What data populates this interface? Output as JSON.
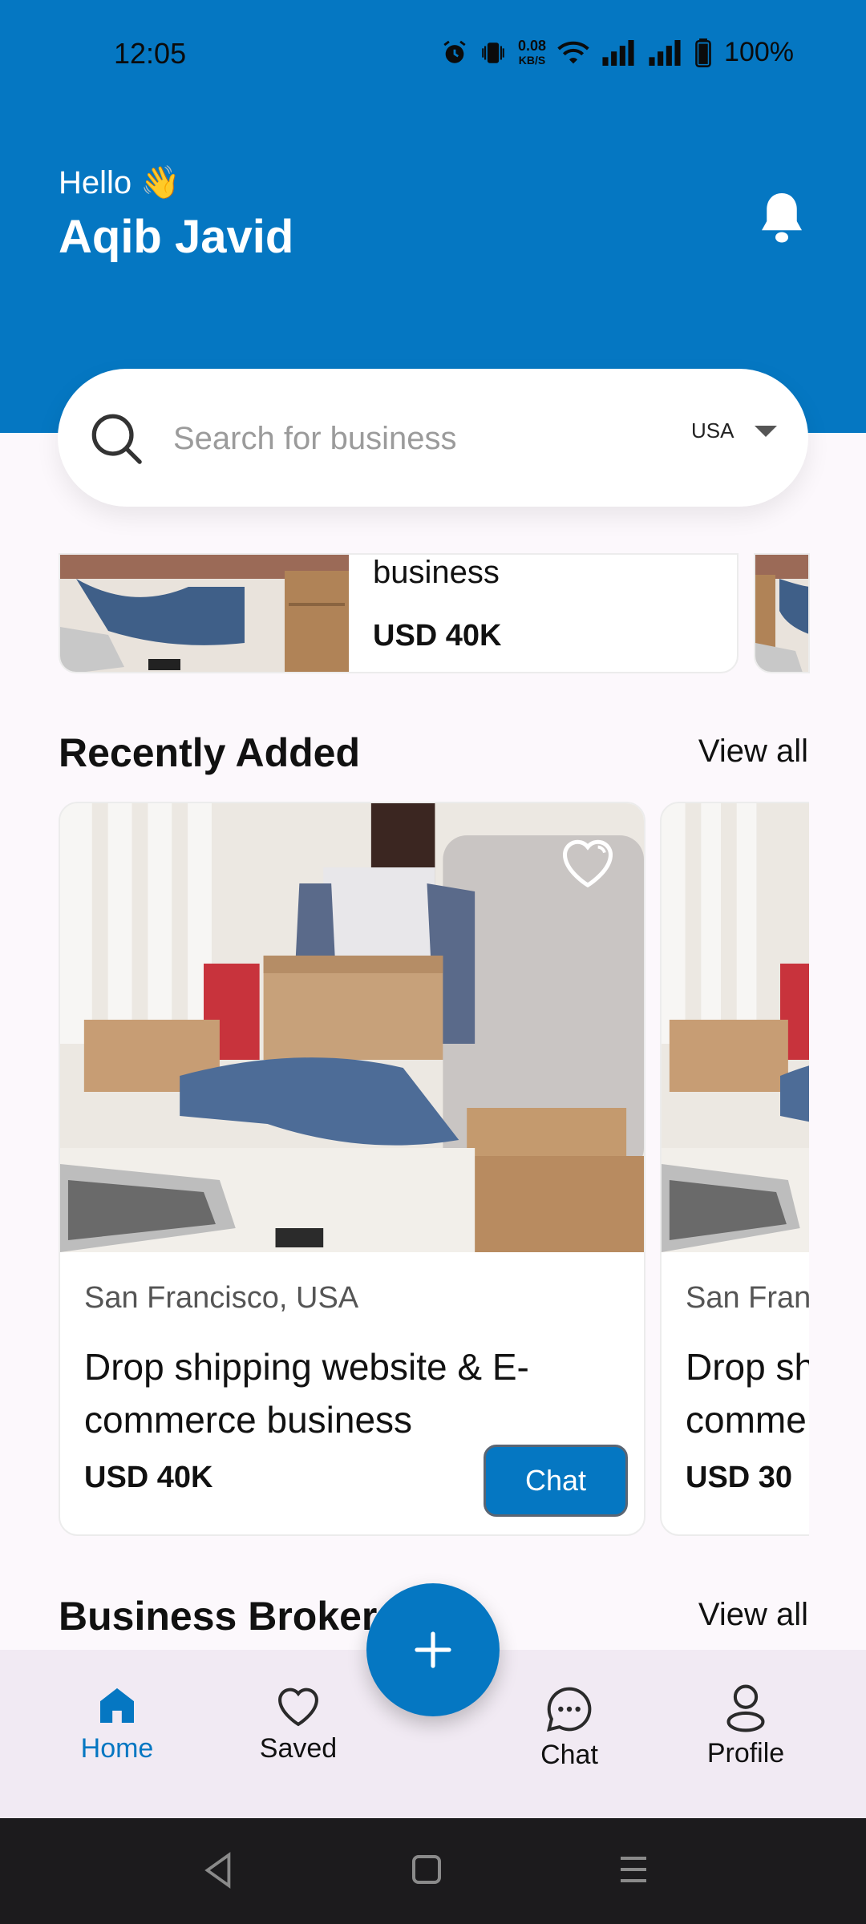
{
  "status_bar": {
    "time": "12:05",
    "net_speed_top": "0.08",
    "net_speed_bottom": "KB/S",
    "battery": "100%"
  },
  "header": {
    "greeting": "Hello 👋",
    "user_name": "Aqib Javid",
    "bell_icon": "bell-icon",
    "bg_color": "#0577c2"
  },
  "search": {
    "placeholder": "Search for business",
    "country": "USA"
  },
  "top_carousel": {
    "title_fragment": "business",
    "price": "USD 40K"
  },
  "recently_added": {
    "title": "Recently Added",
    "view_all": "View all",
    "items": [
      {
        "location": "San Francisco, USA",
        "title": "Drop shipping website & E-commerce business",
        "price": "USD 40K",
        "chat_label": "Chat"
      },
      {
        "location": "San Fran",
        "title": "Drop sh commerce",
        "price": "USD 30",
        "title_line1": "Drop sh",
        "title_line2": "comme"
      }
    ]
  },
  "business_brokers": {
    "title": "Business Broker",
    "view_all": "View all"
  },
  "bottom_nav": {
    "items": [
      {
        "label": "Home",
        "icon": "home-icon",
        "active": true
      },
      {
        "label": "Saved",
        "icon": "heart-icon",
        "active": false
      },
      {
        "label": "Chat",
        "icon": "chat-icon",
        "active": false
      },
      {
        "label": "Profile",
        "icon": "profile-icon",
        "active": false
      }
    ],
    "fab_icon": "plus-icon"
  }
}
